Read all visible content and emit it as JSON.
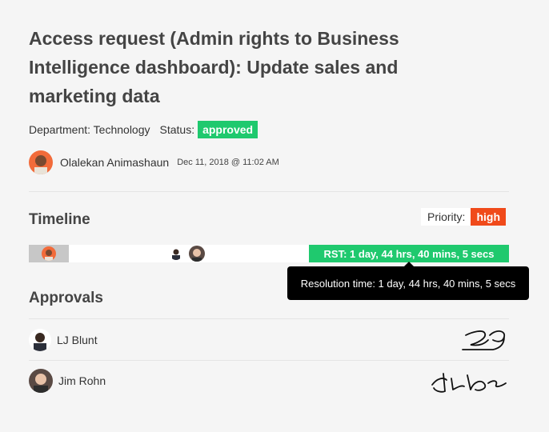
{
  "request": {
    "title": "Access request (Admin rights to Business Intelligence dashboard): Update sales and marketing data",
    "department": "Department: Technology",
    "status_label": "Status:",
    "status": "approved",
    "status_color": "#1fc96e"
  },
  "author": {
    "name": "Olalekan Animashaun",
    "date": "Dec 11, 2018 @ 11:02 AM",
    "avatar_icon": "avatar-olalekan"
  },
  "timeline": {
    "title": "Timeline",
    "priority_label": "Priority:",
    "priority": "high",
    "priority_color": "#f04a1a",
    "rst_label": "RST: 1 day, 44 hrs, 40 mins, 5 secs",
    "tooltip": "Resolution time: 1 day, 44 hrs, 40 mins, 5 secs"
  },
  "approvals": {
    "title": "Approvals",
    "items": [
      {
        "name": "LJ Blunt",
        "avatar_icon": "avatar-lj-blunt",
        "signature_icon": "signature-icon"
      },
      {
        "name": "Jim Rohn",
        "avatar_icon": "avatar-jim-rohn",
        "signature_icon": "signature-icon"
      }
    ]
  }
}
